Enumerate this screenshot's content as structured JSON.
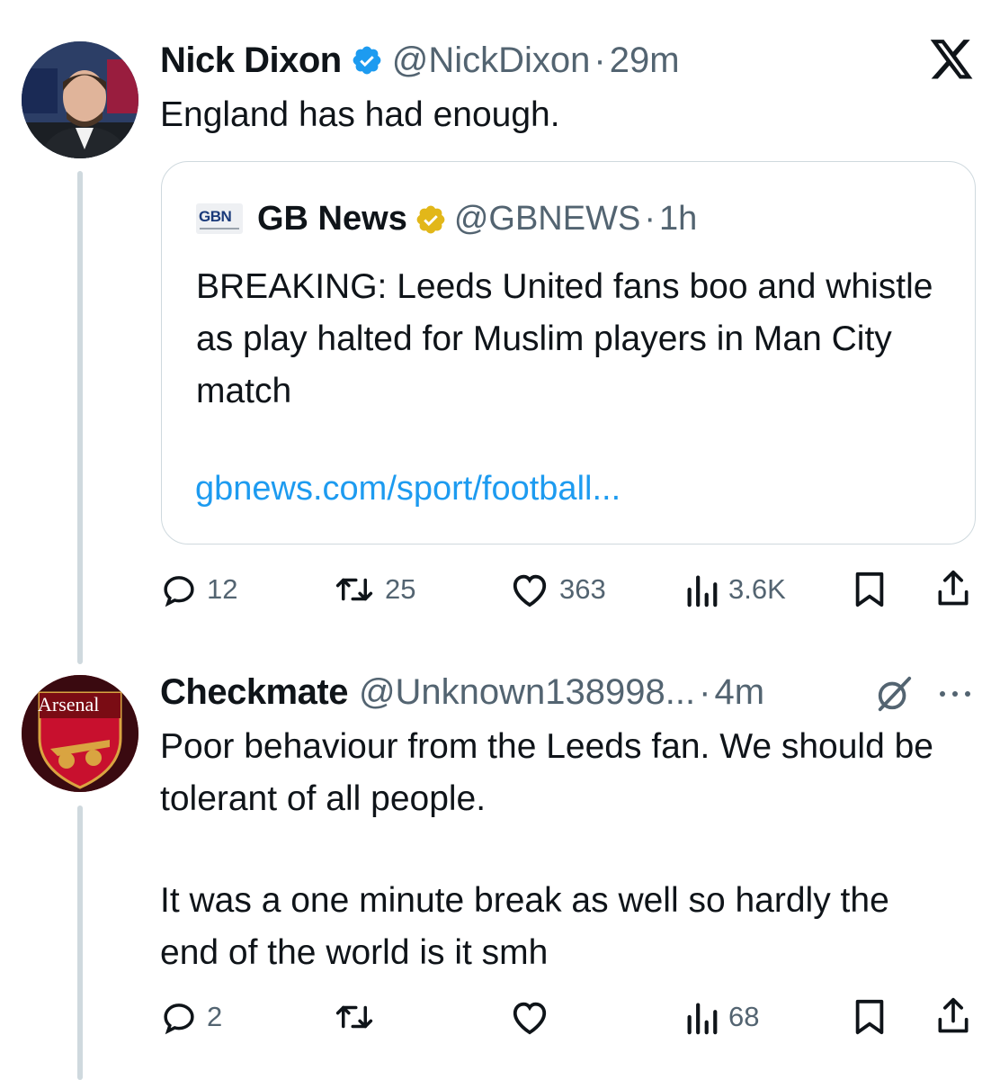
{
  "tweet": {
    "author_name": "Nick Dixon",
    "handle": "@NickDixon",
    "separator": "·",
    "time": "29m",
    "text": "England has had enough.",
    "quote": {
      "logo_text": "GBN",
      "author_name": "GB News",
      "handle": "@GBNEWS",
      "separator": "·",
      "time": "1h",
      "text": "BREAKING: Leeds United fans boo and whistle as play halted for Muslim players in Man City match",
      "link": "gbnews.com/sport/football..."
    },
    "stats": {
      "replies": "12",
      "retweets": "25",
      "likes": "363",
      "views": "3.6K"
    }
  },
  "reply": {
    "avatar_text": "Arsenal",
    "author_name": "Checkmate",
    "handle": "@Unknown138998...",
    "separator": "·",
    "time": "4m",
    "text_p1": "Poor behaviour from the Leeds fan. We should be tolerant of all people.",
    "text_p2": "It was a one minute break as well so hardly the end of the world is it smh",
    "stats": {
      "replies": "2",
      "views": "68"
    }
  },
  "icons": {
    "app_logo": "x-logo-icon",
    "verified_personal": "verified-badge-blue-icon",
    "verified_org": "verified-badge-gold-icon",
    "reply": "reply-icon",
    "retweet": "retweet-icon",
    "like": "heart-icon",
    "views": "views-chart-icon",
    "bookmark": "bookmark-icon",
    "share": "share-icon",
    "grok": "grok-icon",
    "more": "more-icon"
  },
  "colors": {
    "text": "#0f1419",
    "secondary": "#536471",
    "link": "#1d9bf0",
    "verified_blue": "#1d9bf0",
    "verified_gold": "#e2b719",
    "divider": "#cfd9de"
  }
}
